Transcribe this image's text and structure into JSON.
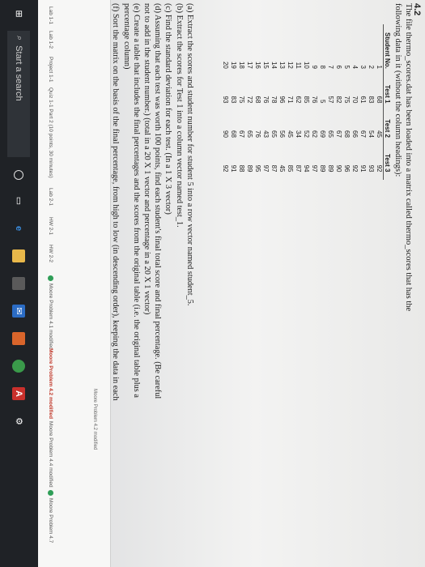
{
  "question": {
    "number": "4.2",
    "intro": "The file thermo_scores.dat has been loaded into a matrix called thermo_scores that has the following data in it (without the column headings):",
    "table": {
      "headers": [
        "Student No.",
        "Test 1",
        "Test 2",
        "Test 3"
      ],
      "rows": [
        [
          "1",
          "68",
          "45",
          "92"
        ],
        [
          "2",
          "83",
          "54",
          "93"
        ],
        [
          "3",
          "61",
          "67",
          "91"
        ],
        [
          "4",
          "70",
          "66",
          "92"
        ],
        [
          "5",
          "75",
          "68",
          "96"
        ],
        [
          "6",
          "82",
          "67",
          "90"
        ],
        [
          "7",
          "57",
          "65",
          "89"
        ],
        [
          "8",
          "5",
          "69",
          "89"
        ],
        [
          "9",
          "76",
          "62",
          "97"
        ],
        [
          "10",
          "85",
          "52",
          "94"
        ],
        [
          "11",
          "62",
          "34",
          "87"
        ],
        [
          "12",
          "71",
          "45",
          "85"
        ],
        [
          "13",
          "96",
          "56",
          "45"
        ],
        [
          "14",
          "78",
          "65",
          "87"
        ],
        [
          "15",
          "76",
          "43",
          "97"
        ],
        [
          "16",
          "68",
          "76",
          "95"
        ],
        [
          "17",
          "72",
          "65",
          "89"
        ],
        [
          "18",
          "75",
          "67",
          "88"
        ],
        [
          "19",
          "83",
          "68",
          "91"
        ],
        [
          "20",
          "93",
          "90",
          "92"
        ]
      ]
    },
    "parts": [
      "(a) Extract the scores and student number for student 5 into a row vector named student_5.",
      "(b) Extract the scores for Test 1 into a column vector named test_1.",
      "(c) Find the standard deviation for each test. (In a 1 X 3 vector)",
      "(d) Assuming that each test was worth 100 points, find each student's final total score and final percentage. (Be careful not to add in the student number.) (total in a 20 X 1 vector and percentage in a 20 X 1 vector)",
      "(e) Create a table that includes the final percentages and the scores from the original table (i.e. the original table plus a percentage column)",
      "(f) Sort the matrix on the basis of the final percentage, from high to low (in descending order), keeping the data in each row together. (You may need to consult the help function to determine the proper syntax.)"
    ]
  },
  "sidebar": {
    "items": [
      {
        "label": "Lab 1-1"
      },
      {
        "label": "Lab 1-2"
      },
      {
        "label": "Project 1-1"
      },
      {
        "label": "Quiz 1-1 Part 2 (10 points, 30 minutes)"
      },
      {
        "label": "Lab 2-1"
      },
      {
        "label": "HW 2-1"
      },
      {
        "label": "HW 2-2"
      },
      {
        "label": "Moore Problem 4.1 modified"
      },
      {
        "label": "Moore Problem 4.2 modified"
      },
      {
        "label": "Moore Problem 4.4 modified"
      },
      {
        "label": "Moore Problem 4.7"
      }
    ]
  },
  "footer_note": "Moore Problem 4.2 modified",
  "taskbar": {
    "search_placeholder": "Start a search",
    "app_icons": [
      "windows-icon",
      "search-icon",
      "task-view-icon",
      "edge-icon",
      "file-explorer-icon",
      "store-icon",
      "mail-icon",
      "matlab-icon",
      "chrome-icon",
      "acrobat-icon",
      "settings-icon"
    ]
  },
  "colors": {
    "taskbar": "#1f2226",
    "accent_green": "#2f9e57"
  }
}
